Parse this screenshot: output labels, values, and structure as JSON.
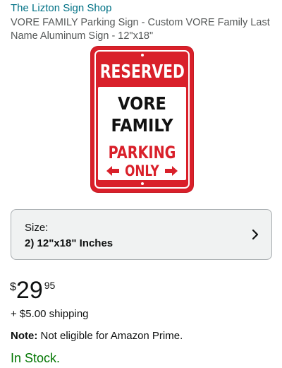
{
  "product": {
    "brand": "The Lizton Sign Shop",
    "title": "VORE FAMILY Parking Sign - Custom VORE Family Last Name Aluminum Sign - 12\"x18\""
  },
  "sign": {
    "top_text": "RESERVED",
    "line1": "VORE",
    "line2": "FAMILY",
    "line3": "PARKING",
    "line4": "ONLY",
    "colors": {
      "red": "#d9202a",
      "white": "#ffffff",
      "black": "#111111"
    }
  },
  "size_selector": {
    "label": "Size:",
    "value": "2) 12\"x18\" Inches",
    "icon": "chevron-right-icon"
  },
  "price": {
    "currency": "$",
    "whole": "29",
    "fraction": "95"
  },
  "shipping": "+ $5.00 shipping",
  "note": {
    "label": "Note:",
    "text": "Not eligible for Amazon Prime."
  },
  "availability": "In Stock.",
  "colors": {
    "link": "#007185",
    "in_stock": "#007600",
    "selector_bg": "#f0f2f2"
  }
}
